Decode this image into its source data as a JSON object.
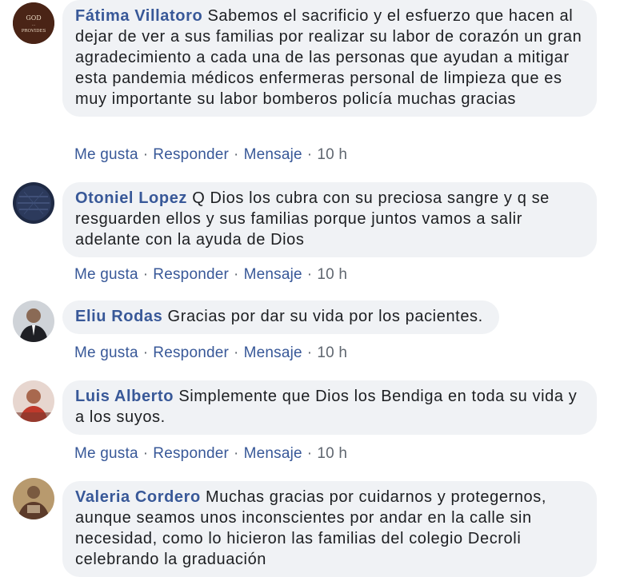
{
  "actions": {
    "like": "Me gusta",
    "reply": "Responder",
    "message": "Mensaje",
    "separator": "·"
  },
  "comments": [
    {
      "author": "Fátima Villatoro",
      "text": "Sabemos el sacrificio y el esfuerzo que hacen al dejar de ver a sus familias por realizar su labor de corazón un gran agradecimiento a cada una de las personas que ayudan a mitigar esta pandemia médicos enfermeras personal de limpieza que es muy importante su labor bomberos policía muchas gracias",
      "time": "10 h",
      "avatar_text": "GOD PROVIDES"
    },
    {
      "author": "Otoniel Lopez",
      "text": "Q Dios los cubra con su preciosa sangre y q se resguarden ellos y sus familias porque juntos vamos a salir adelante con la ayuda de Dios",
      "time": "10 h"
    },
    {
      "author": "Eliu Rodas",
      "text": "Gracias por dar su vida por los pacientes.",
      "time": "10 h"
    },
    {
      "author": "Luis Alberto",
      "text": "Simplemente que Dios los Bendiga en toda su vida y a los suyos.",
      "time": "10 h"
    },
    {
      "author": "Valeria Cordero",
      "text": "Muchas gracias por cuidarnos y protegernos, aunque seamos unos inconscientes por andar en la calle sin necesidad, como lo hicieron las familias del colegio Decroli celebrando la graduación",
      "time": ""
    }
  ]
}
